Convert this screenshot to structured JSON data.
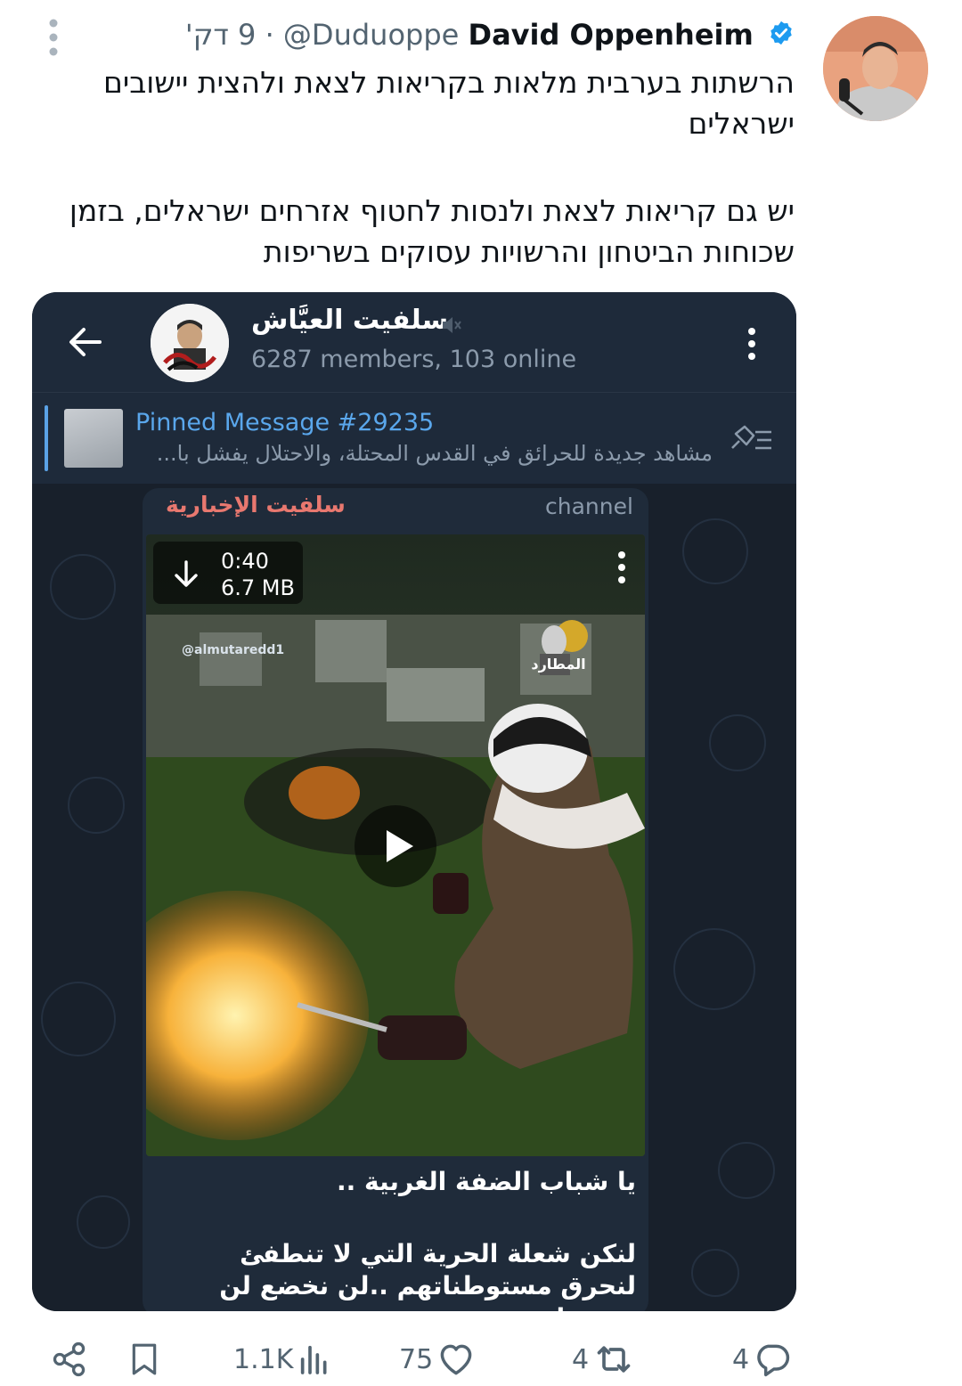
{
  "tweet": {
    "author_name": "David Oppenheim",
    "handle": "@Duduoppe",
    "time": "9 דק'",
    "separator": "·",
    "paragraph1": "הרשתות בערבית מלאות בקריאות לצאת ולהצית יישובים ישראלים",
    "paragraph2": "יש גם קריאות לצאת ולנסות לחטוף אזרחים ישראלים, בזמן שכוחות הביטחון והרשויות עסוקים בשריפות"
  },
  "telegram": {
    "channel_title": "سلفيت العيَّاش",
    "members": "6287 members, 103 online",
    "pinned_title": "Pinned Message #29235",
    "pinned_text": "مشاهد جديدة للحرائق في القدس المحتلة، والاحتلال يفشل با...",
    "post": {
      "sender": "سلفيت الإخبارية",
      "badge": "channel",
      "video_duration": "0:40",
      "video_size": "6.7 MB",
      "watermark": "@almutaredd1",
      "logo_text": "المطارد",
      "caption_line1": "يا شباب الضفة الغربية ..",
      "caption_line2": "لنكن شعلة الحرية التي لا تنطفئ لنحرق مستوطناتهم ..لن نخضع لن نستسلم .."
    }
  },
  "actions": {
    "replies": "4",
    "retweets": "4",
    "likes": "75",
    "views": "1.1K"
  },
  "colors": {
    "verified": "#1d9bf0",
    "text_secondary": "#536471",
    "telegram_header": "#1e2a3a",
    "telegram_link": "#5aa7ec",
    "sender_name": "#e8786f"
  }
}
